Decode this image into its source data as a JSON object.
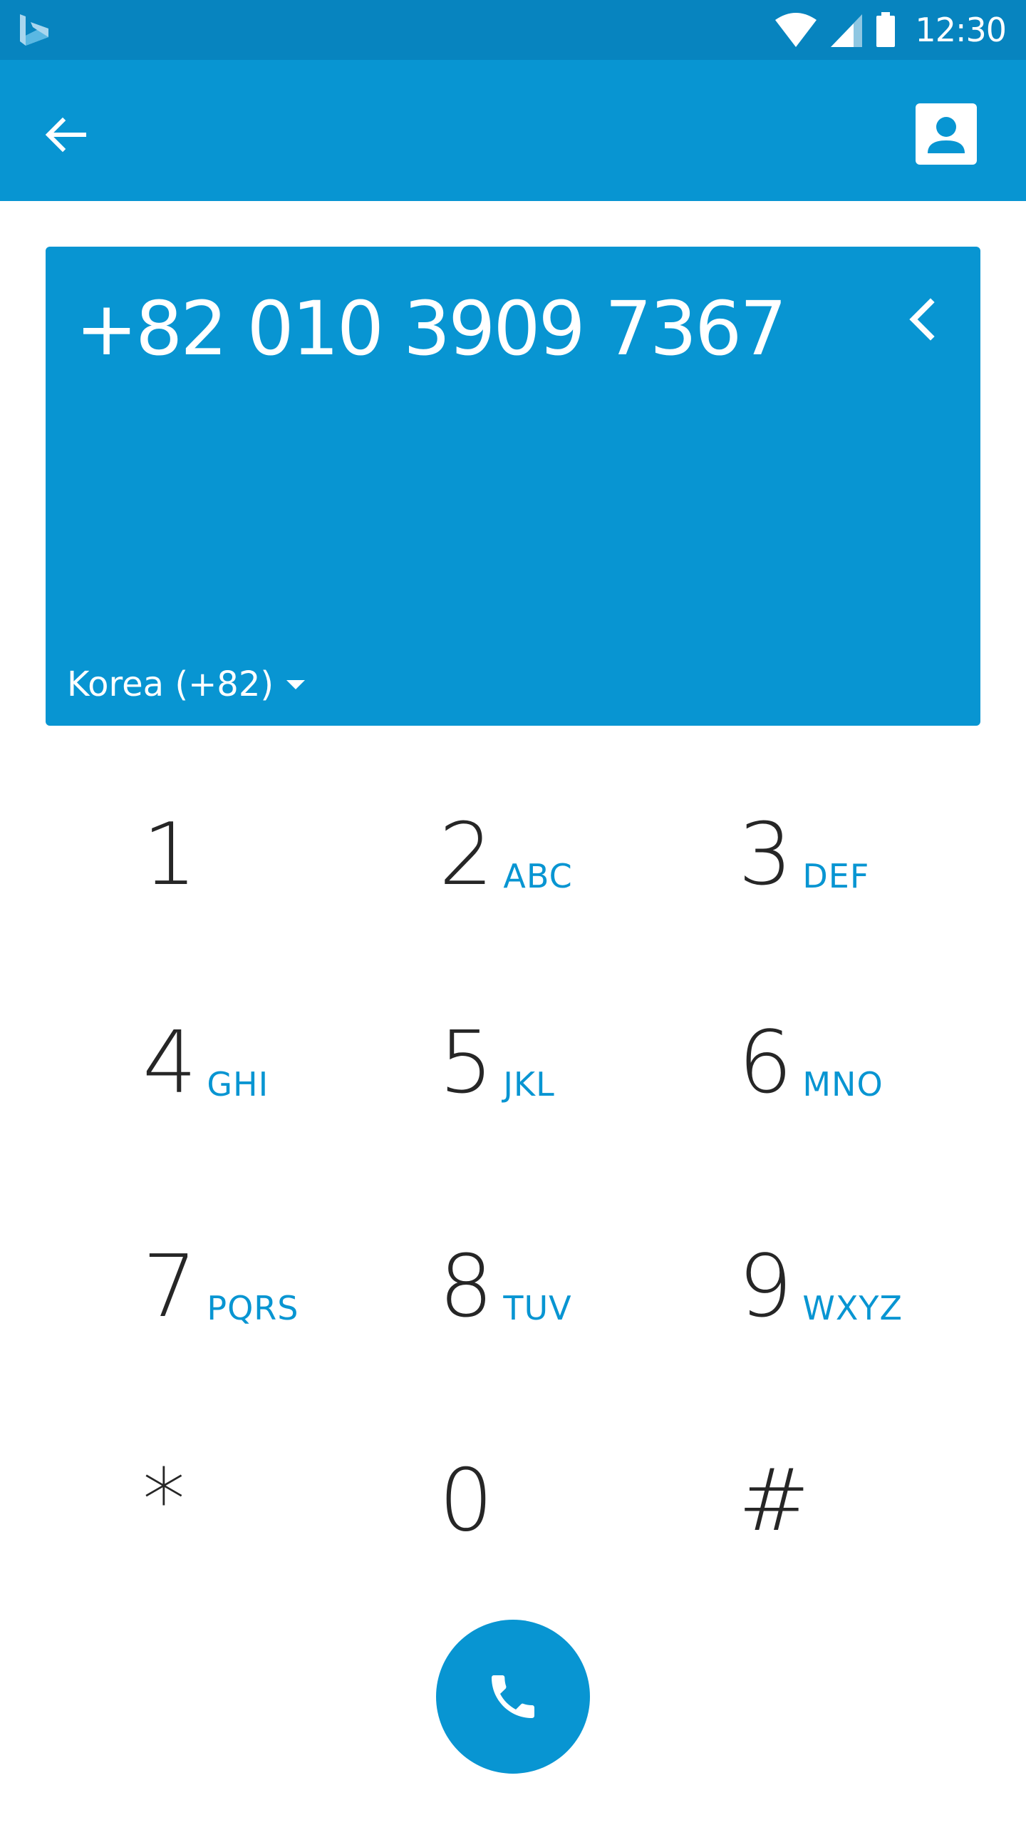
{
  "status_bar": {
    "time": "12:30",
    "icons": [
      "bing-logo-icon",
      "wifi-icon",
      "cell-signal-icon",
      "battery-icon"
    ]
  },
  "app_bar": {
    "icons": [
      "back-arrow-icon",
      "contacts-icon"
    ]
  },
  "dialer": {
    "number": "+82 010 3909 7367",
    "country": "Korea (+82)",
    "icons": [
      "backspace-chevron-icon",
      "dropdown-triangle-icon"
    ]
  },
  "keypad": {
    "keys": [
      {
        "digit": "1",
        "letters": ""
      },
      {
        "digit": "2",
        "letters": "ABC"
      },
      {
        "digit": "3",
        "letters": "DEF"
      },
      {
        "digit": "4",
        "letters": "GHI"
      },
      {
        "digit": "5",
        "letters": "JKL"
      },
      {
        "digit": "6",
        "letters": "MNO"
      },
      {
        "digit": "7",
        "letters": "PQRS"
      },
      {
        "digit": "8",
        "letters": "TUV"
      },
      {
        "digit": "9",
        "letters": "WXYZ"
      },
      {
        "digit": "*",
        "letters": ""
      },
      {
        "digit": "0",
        "letters": ""
      },
      {
        "digit": "#",
        "letters": ""
      }
    ]
  },
  "call": {
    "icon": "phone-icon"
  },
  "colors": {
    "status_bar": "#0784bf",
    "primary": "#0895d2",
    "digit_text": "#262626",
    "background": "#ffffff"
  }
}
